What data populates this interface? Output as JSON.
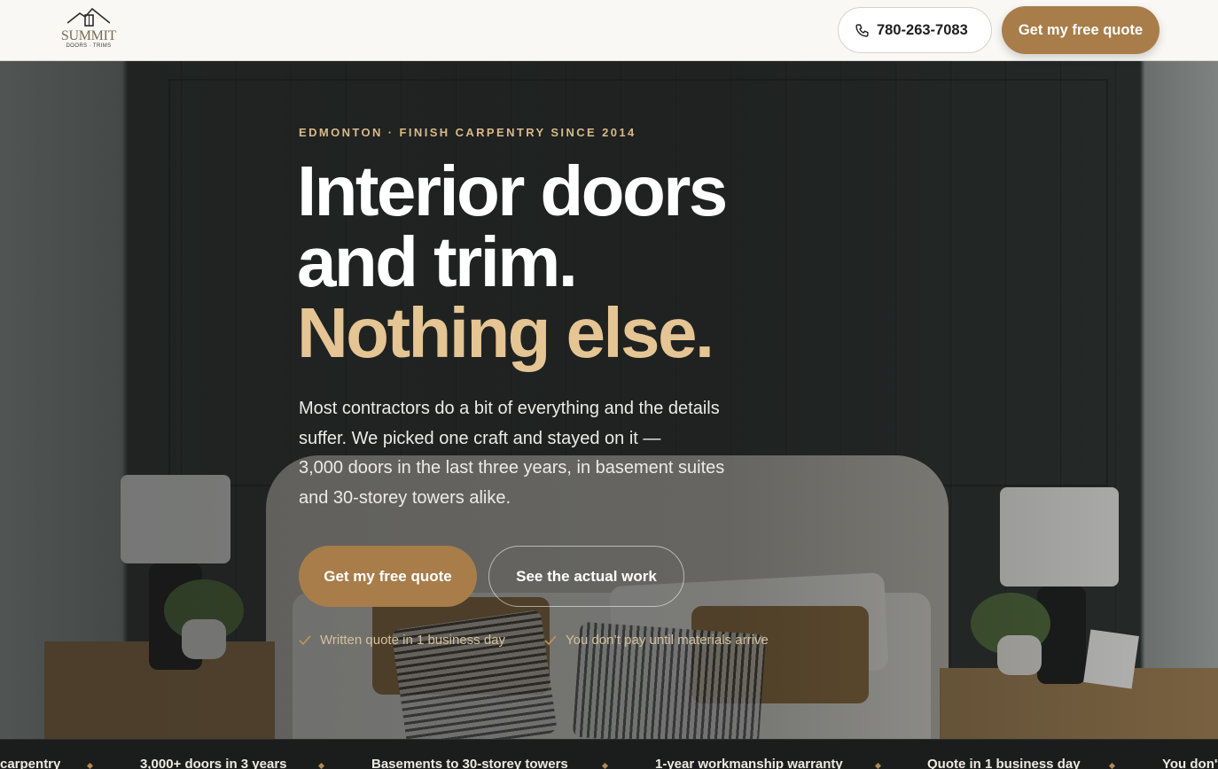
{
  "header": {
    "logo_word": "SUMMIT",
    "logo_sub": "DOORS · TRIMS",
    "phone": "780-263-7083",
    "quote_button": "Get my free quote"
  },
  "hero": {
    "eyebrow": "EDMONTON · FINISH CARPENTRY SINCE 2014",
    "headline_line1": "Interior doors",
    "headline_line2": "and trim.",
    "headline_accent": "Nothing else.",
    "lead_lines": [
      "Most contractors do a bit of everything and the details",
      "suffer. We picked one craft and stayed on it —",
      "3,000 doors in the last three years, in basement suites",
      "and 30-storey towers alike."
    ],
    "primary_cta": "Get my free quote",
    "secondary_cta": "See the actual work",
    "assurances": [
      "Written quote in 1 business day",
      "You don’t pay until materials arrive"
    ]
  },
  "ticker": {
    "items": [
      "carpentry",
      "3,000+ doors in 3 years",
      "Basements to 30-storey towers",
      "1-year workmanship warranty",
      "Quote in 1 business day",
      "You don't"
    ]
  },
  "colors": {
    "accent": "#a87d4a",
    "headline_accent": "#e5c594",
    "eyebrow": "#d9b988",
    "header_bg": "#faf8f4"
  }
}
